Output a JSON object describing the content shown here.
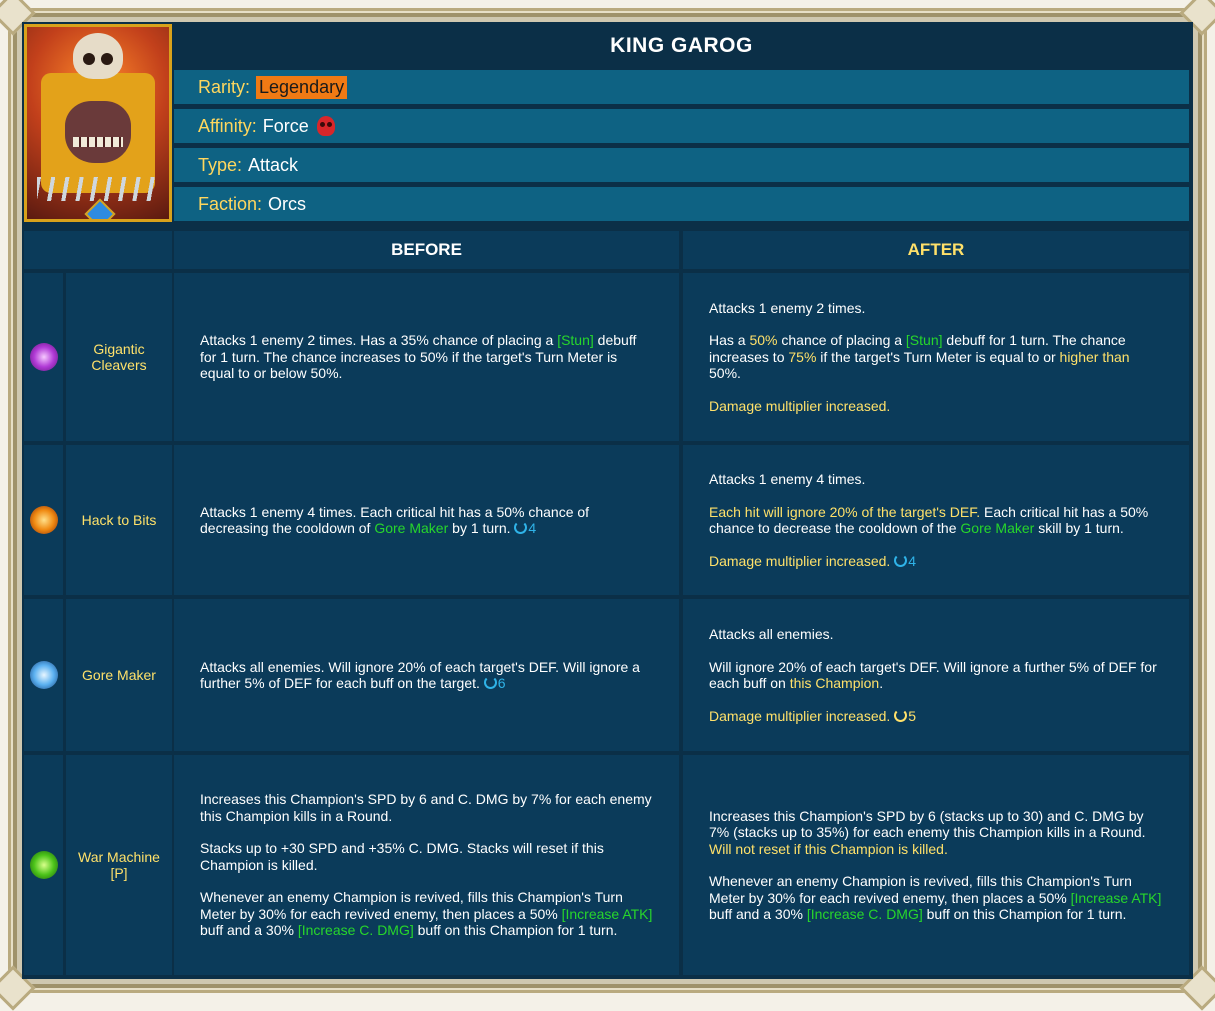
{
  "champion": {
    "name": "KING GAROG",
    "rarity_label": "Rarity:",
    "rarity": "Legendary",
    "affinity_label": "Affinity:",
    "affinity": "Force",
    "type_label": "Type:",
    "type": "Attack",
    "faction_label": "Faction:",
    "faction": "Orcs"
  },
  "columns": {
    "before": "BEFORE",
    "after": "AFTER"
  },
  "skills": [
    {
      "icon": "purple-cleaver-icon",
      "name": "Gigantic Cleavers",
      "before": {
        "p1_a": "Attacks 1 enemy 2 times. Has a 35% chance of placing a ",
        "p1_stun": "[Stun]",
        "p1_b": " debuff for 1 turn. The chance increases to 50% if the target's Turn Meter is equal to or below 50%."
      },
      "after": {
        "p1": "Attacks 1 enemy 2 times.",
        "p2_a": "Has a ",
        "p2_pct1": "50%",
        "p2_b": " chance of placing a ",
        "p2_stun": "[Stun]",
        "p2_c": " debuff for 1 turn. The chance increases to ",
        "p2_pct2": "75%",
        "p2_d": " if the target's Turn Meter is equal to or ",
        "p2_higher": "higher than",
        "p2_e": " 50%.",
        "p3": "Damage multiplier increased."
      }
    },
    {
      "icon": "fire-axe-icon",
      "name": "Hack to Bits",
      "before": {
        "p1_a": "Attacks 1 enemy 4 times. Each critical hit has a 50% chance of decreasing the cooldown of ",
        "p1_gore": "Gore Maker",
        "p1_b": " by 1 turn. ",
        "cooldown": "4"
      },
      "after": {
        "p1": "Attacks 1 enemy 4 times.",
        "p2_ignore": "Each hit will ignore 20% of the target's DEF.",
        "p2_a": " Each critical hit has a 50% chance to decrease the cooldown of the ",
        "p2_gore": "Gore Maker",
        "p2_b": " skill by 1 turn.",
        "p3": "Damage multiplier increased. ",
        "cooldown": "4"
      }
    },
    {
      "icon": "ice-claw-icon",
      "name": "Gore Maker",
      "before": {
        "p1": "Attacks all enemies. Will ignore 20% of each target's DEF. Will ignore a further 5% of DEF for each buff on the target. ",
        "cooldown": "6"
      },
      "after": {
        "p1": "Attacks all enemies.",
        "p2_a": "Will ignore 20% of each target's DEF. Will ignore a further 5% of DEF for each buff on ",
        "p2_this": "this Champion",
        "p2_b": ".",
        "p3": "Damage multiplier increased. ",
        "cooldown": "5"
      }
    },
    {
      "icon": "war-machine-icon",
      "name": "War Machine [P]",
      "before": {
        "p1": "Increases this Champion's SPD by 6 and C. DMG by 7% for each enemy this Champion kills in a Round.",
        "p2": "Stacks up to +30 SPD and +35% C. DMG. Stacks will reset if this Champion is killed.",
        "p3_a": "Whenever an enemy Champion is revived, fills this Champion's Turn Meter by 30% for each revived enemy, then places a 50% ",
        "p3_atk": "[Increase ATK]",
        "p3_b": " buff and a 30% ",
        "p3_cdmg": "[Increase C. DMG]",
        "p3_c": " buff on this Champion for 1 turn."
      },
      "after": {
        "p1_a": "Increases this Champion's SPD by 6 (stacks up to 30) and C. DMG by 7% (stacks up to 35%) for each enemy this Champion kills in a Round. ",
        "p1_reset": "Will not reset if this Champion is killed.",
        "p2_a": "Whenever an enemy Champion is revived, fills this Champion's Turn Meter by 30% for each revived enemy, then places a 50% ",
        "p2_atk": "[Increase ATK]",
        "p2_b": " buff and a 30% ",
        "p2_cdmg": "[Increase C. DMG]",
        "p2_c": " buff on this Champion for 1 turn."
      }
    }
  ],
  "colors": {
    "panel": "#0b3b5a",
    "info": "#0e6283",
    "highlight": "#ffe16a",
    "buff": "#27d62b",
    "cooldown": "#2fb3e8",
    "legendary": "#f07a14"
  }
}
